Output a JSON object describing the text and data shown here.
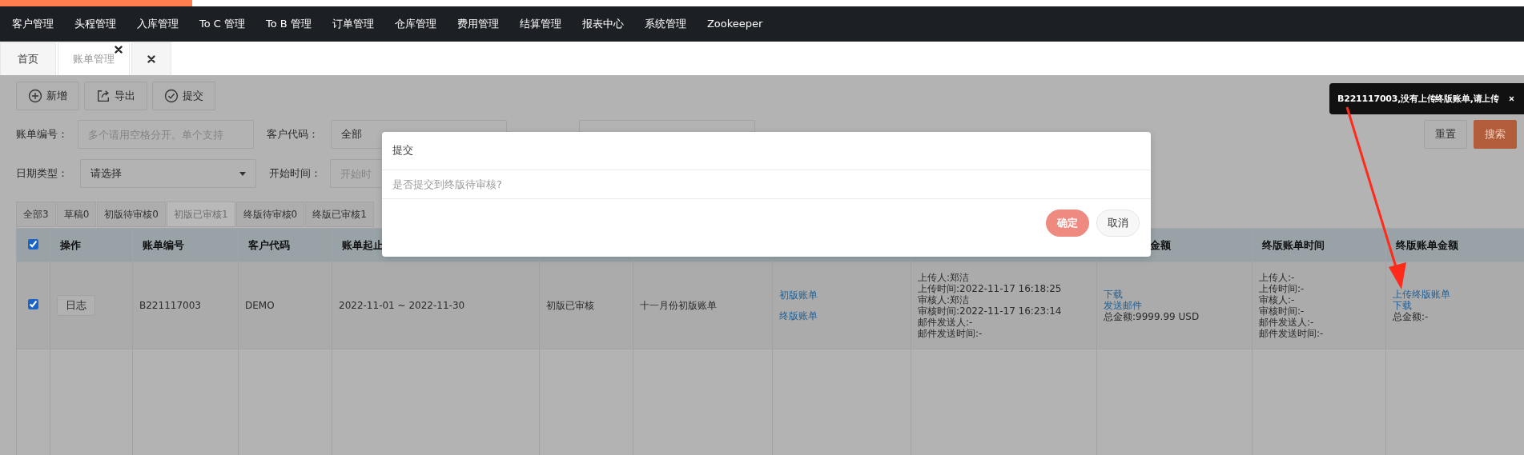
{
  "nav": {
    "items": [
      "客户管理",
      "头程管理",
      "入库管理",
      "To C 管理",
      "To B 管理",
      "订单管理",
      "仓库管理",
      "费用管理",
      "结算管理",
      "报表中心",
      "系统管理",
      "Zookeeper"
    ]
  },
  "page_tabs": [
    {
      "kind": "tab",
      "label": "首页",
      "selected": false
    },
    {
      "kind": "tab",
      "label": "账单管理",
      "selected": true,
      "closable": true
    }
  ],
  "toolbar": [
    {
      "kind": "add",
      "label": "新增"
    },
    {
      "kind": "export",
      "label": "导出"
    },
    {
      "kind": "submit",
      "label": "提交"
    }
  ],
  "filters": [
    [
      {
        "label": "账单编号：",
        "kind": "input",
        "placeholder": "多个请用空格分开。单个支持"
      },
      {
        "label": "客户代码：",
        "kind": "select",
        "value": "全部"
      },
      {
        "kind": "input"
      }
    ],
    [
      {
        "label": "日期类型：",
        "kind": "dropdown",
        "value": "请选择"
      },
      {
        "label": "开始时间：",
        "kind": "input",
        "placeholder": "开始时"
      }
    ]
  ],
  "search_buttons": [
    {
      "kind": "default",
      "label": "重置"
    },
    {
      "kind": "primary",
      "label": "搜索"
    }
  ],
  "status_tabs": [
    {
      "label": "全部3",
      "selected": false
    },
    {
      "label": "草稿0",
      "selected": false
    },
    {
      "label": "初版待审核0",
      "selected": false
    },
    {
      "label": "初版已审核1",
      "selected": true
    },
    {
      "label": "终版待审核0",
      "selected": false
    },
    {
      "label": "终版已审核1",
      "selected": false
    }
  ],
  "table": {
    "columns": [
      {
        "kind": "checkbox",
        "checked": true
      },
      {
        "label": "操作"
      },
      {
        "label": "账单编号"
      },
      {
        "label": "客户代码"
      },
      {
        "label": "账单起止"
      },
      {},
      {},
      {},
      {},
      {
        "label": "金额"
      },
      {
        "label": "终版账单时间"
      },
      {
        "label": "终版账单金额"
      }
    ],
    "rows": [
      {
        "cells": [
          {
            "kind": "checkbox",
            "checked": true
          },
          {
            "kind": "button",
            "text": "日志"
          },
          {
            "kind": "text",
            "text": "B221117003"
          },
          {
            "kind": "text",
            "text": "DEMO"
          },
          {
            "kind": "text",
            "text": "2022-11-01 ~ 2022-11-30"
          },
          {
            "kind": "text",
            "text": "初版已审核"
          },
          {
            "kind": "text",
            "text": "十一月份初版账单"
          },
          {
            "kind": "links",
            "lines": [
              {
                "kind": "link",
                "text": "初版账单"
              },
              {
                "kind": "link",
                "text": "终版账单"
              }
            ]
          },
          {
            "kind": "lines",
            "lines": [
              {
                "kind": "text",
                "text": "上传人:郑洁"
              },
              {
                "kind": "text",
                "text": "上传时间:2022-11-17 16:18:25"
              },
              {
                "kind": "text",
                "text": "审核人:郑洁"
              },
              {
                "kind": "text",
                "text": "审核时间:2022-11-17 16:23:14"
              },
              {
                "kind": "text",
                "text": "邮件发送人:-"
              },
              {
                "kind": "text",
                "text": "邮件发送时间:-"
              }
            ]
          },
          {
            "kind": "lines",
            "lines": [
              {
                "kind": "link",
                "text": "下载"
              },
              {
                "kind": "link",
                "text": "发送邮件"
              },
              {
                "kind": "text",
                "text": "总金额:9999.99 USD"
              }
            ]
          },
          {
            "kind": "lines",
            "lines": [
              {
                "kind": "text",
                "text": "上传人:-"
              },
              {
                "kind": "text",
                "text": "上传时间:-"
              },
              {
                "kind": "text",
                "text": "审核人:-"
              },
              {
                "kind": "text",
                "text": "审核时间:-"
              },
              {
                "kind": "text",
                "text": "邮件发送人:-"
              },
              {
                "kind": "text",
                "text": "邮件发送时间:-"
              }
            ]
          },
          {
            "kind": "lines",
            "lines": [
              {
                "kind": "link",
                "text": "上传终版账单"
              },
              {
                "kind": "link",
                "text": "下载"
              },
              {
                "kind": "text",
                "text": "总金额:-"
              }
            ]
          }
        ]
      }
    ]
  },
  "dialog": {
    "title": "提交",
    "message": "是否提交到终版待审核?",
    "buttons": [
      {
        "kind": "primary",
        "label": "确定"
      },
      {
        "kind": "default",
        "label": "取消"
      }
    ]
  },
  "toast": {
    "message": "B221117003,没有上传终版账单,请上传"
  }
}
